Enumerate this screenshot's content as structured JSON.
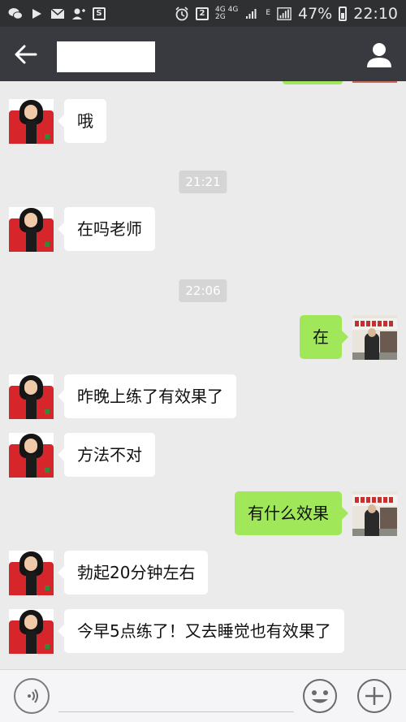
{
  "status_bar": {
    "battery_percent": "47%",
    "time": "22:10",
    "network_badge": "2",
    "network_labels": [
      "4G",
      "4G",
      "2G"
    ],
    "roaming_letter": "E",
    "icons": [
      "wechat-icon",
      "play-icon",
      "mail-icon",
      "contact-icon",
      "s-app-icon",
      "alarm-icon",
      "sim-icon",
      "signal-icon",
      "battery-icon"
    ]
  },
  "header": {
    "back_icon": "arrow-left-icon",
    "title": "",
    "profile_icon": "person-icon"
  },
  "messages": [
    {
      "type": "incoming",
      "text": "哦"
    },
    {
      "type": "time",
      "text": "21:21"
    },
    {
      "type": "incoming",
      "text": "在吗老师"
    },
    {
      "type": "time",
      "text": "22:06"
    },
    {
      "type": "outgoing",
      "text": "在"
    },
    {
      "type": "incoming",
      "text": "昨晚上练了有效果了"
    },
    {
      "type": "incoming",
      "text": "方法不对"
    },
    {
      "type": "outgoing",
      "text": "有什么效果"
    },
    {
      "type": "incoming",
      "text": "勃起20分钟左右"
    },
    {
      "type": "incoming",
      "text": "今早5点练了！又去睡觉也有效果了"
    }
  ],
  "input_bar": {
    "voice_icon": "voice-icon",
    "input_value": "",
    "emoji_icon": "emoji-icon",
    "plus_icon": "plus-icon"
  },
  "colors": {
    "status_bar": "#2f3032",
    "title_bar": "#393a3f",
    "chat_background": "#ebebeb",
    "outgoing_bubble": "#a0e75a",
    "incoming_bubble": "#ffffff",
    "time_badge": "#d5d5d5"
  }
}
